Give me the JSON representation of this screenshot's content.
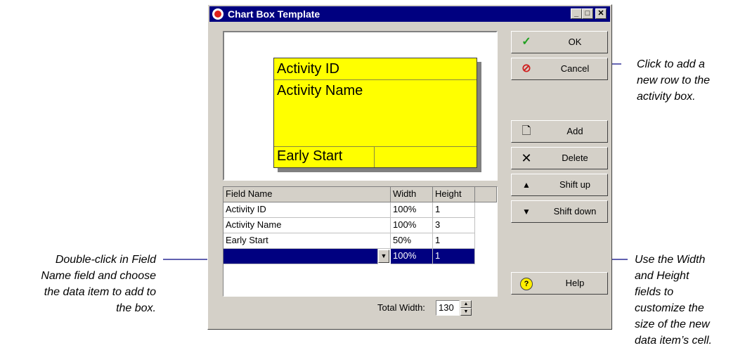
{
  "window": {
    "title": "Chart Box Template"
  },
  "preview": {
    "line1": "Activity ID",
    "line2": "Activity Name",
    "line3": "Early Start"
  },
  "grid": {
    "headers": [
      "Field Name",
      "Width",
      "Height"
    ],
    "rows": [
      [
        "Activity ID",
        "100%",
        "1"
      ],
      [
        "Activity Name",
        "100%",
        "3"
      ],
      [
        "Early Start",
        "50%",
        "1"
      ],
      [
        "",
        "100%",
        "1"
      ]
    ]
  },
  "total_width": {
    "label": "Total Width:",
    "value": "130"
  },
  "buttons": {
    "ok": "OK",
    "cancel": "Cancel",
    "add": "Add",
    "delete": "Delete",
    "shift_up": "Shift up",
    "shift_down": "Shift down",
    "help": "Help"
  },
  "callouts": {
    "add": [
      "Click to add a",
      "new row to the",
      "activity box."
    ],
    "field": [
      "Double-click in Field",
      "Name field and choose",
      "the data item to add to",
      "the box."
    ],
    "size": [
      "Use the Width",
      "and Height",
      "fields to",
      "customize the",
      "size of the new",
      "data item’s cell."
    ]
  },
  "colors": {
    "titlebar": "#000080",
    "activity_box": "#ffff00",
    "selection": "#000080"
  }
}
